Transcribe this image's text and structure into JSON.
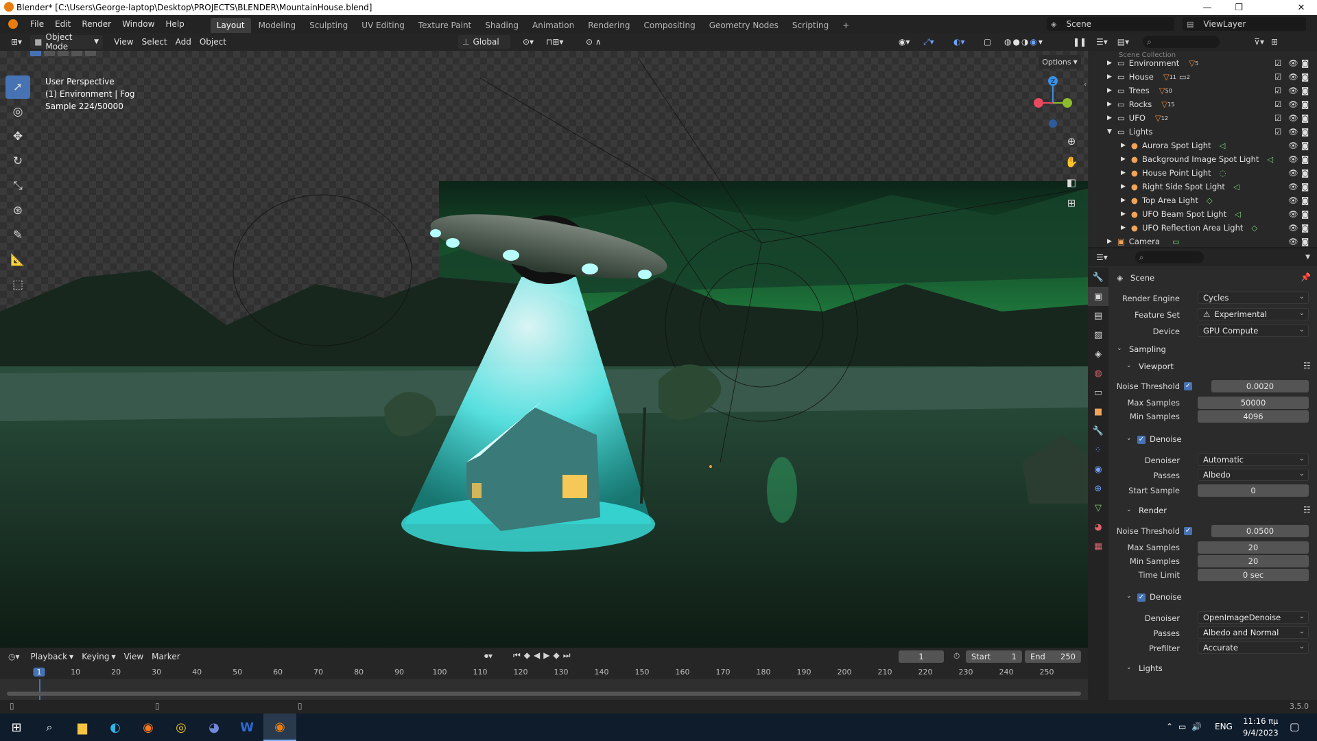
{
  "window": {
    "title": "Blender* [C:\\Users\\George-laptop\\Desktop\\PROJECTS\\BLENDER\\MountainHouse.blend]",
    "minimize": "—",
    "maximize": "❐",
    "close": "✕"
  },
  "menu": [
    "File",
    "Edit",
    "Render",
    "Window",
    "Help"
  ],
  "workspaces": [
    "Layout",
    "Modeling",
    "Sculpting",
    "UV Editing",
    "Texture Paint",
    "Shading",
    "Animation",
    "Rendering",
    "Compositing",
    "Geometry Nodes",
    "Scripting"
  ],
  "add_workspace": "+",
  "scene": {
    "name": "Scene",
    "view_layer": "ViewLayer"
  },
  "viewport_header": {
    "mode": "Object Mode",
    "menus": [
      "View",
      "Select",
      "Add",
      "Object"
    ],
    "orientation": "Global",
    "options": "Options"
  },
  "overlay_text": {
    "line1": "User Perspective",
    "line2": "(1) Environment | Fog",
    "line3": "Sample 224/50000"
  },
  "gizmo": {
    "z": "Z",
    "y": "Y",
    "x": "X"
  },
  "outliner": {
    "partial_top": "Scene Collection",
    "collections": [
      {
        "name": "Environment",
        "count": "5"
      },
      {
        "name": "House",
        "count": "11"
      },
      {
        "name": "Trees",
        "count": "50"
      },
      {
        "name": "Rocks",
        "count": "15"
      },
      {
        "name": "UFO",
        "count": "12"
      },
      {
        "name": "Lights",
        "count": ""
      }
    ],
    "lights": [
      "Aurora Spot Light",
      "Background Image Spot Light",
      "House Point Light",
      "Right Side Spot Light",
      "Top Area Light",
      "UFO Beam Spot Light",
      "UFO Reflection Area Light"
    ],
    "camera": "Camera",
    "house_sub": "2"
  },
  "properties": {
    "header": "Scene",
    "render_engine_label": "Render Engine",
    "render_engine": "Cycles",
    "feature_set_label": "Feature Set",
    "feature_set": "Experimental",
    "device_label": "Device",
    "device": "GPU Compute",
    "sampling": "Sampling",
    "viewport": "Viewport",
    "v_noise_label": "Noise Threshold",
    "v_noise": "0.0020",
    "v_max_label": "Max Samples",
    "v_max": "50000",
    "v_min_label": "Min Samples",
    "v_min": "4096",
    "v_denoise": "Denoise",
    "v_denoiser_label": "Denoiser",
    "v_denoiser": "Automatic",
    "v_passes_label": "Passes",
    "v_passes": "Albedo",
    "v_start_label": "Start Sample",
    "v_start": "0",
    "render": "Render",
    "r_noise_label": "Noise Threshold",
    "r_noise": "0.0500",
    "r_max_label": "Max Samples",
    "r_max": "20",
    "r_min_label": "Min Samples",
    "r_min": "20",
    "r_time_label": "Time Limit",
    "r_time": "0 sec",
    "r_denoise": "Denoise",
    "r_denoiser_label": "Denoiser",
    "r_denoiser": "OpenImageDenoise",
    "r_passes_label": "Passes",
    "r_passes": "Albedo and Normal",
    "r_prefilter_label": "Prefilter",
    "r_prefilter": "Accurate",
    "lights": "Lights"
  },
  "timeline": {
    "menus": [
      "Playback",
      "Keying",
      "View",
      "Marker"
    ],
    "current_frame": "1",
    "start_label": "Start",
    "start": "1",
    "end_label": "End",
    "end": "250",
    "ticks": [
      "1",
      "10",
      "20",
      "30",
      "40",
      "50",
      "60",
      "70",
      "80",
      "90",
      "100",
      "110",
      "120",
      "130",
      "140",
      "150",
      "160",
      "170",
      "180",
      "190",
      "200",
      "210",
      "220",
      "230",
      "240",
      "250"
    ]
  },
  "statusbar": {
    "version": "3.5.0"
  },
  "taskbar": {
    "lang": "ENG",
    "time": "11:16 πμ",
    "date": "9/4/2023"
  }
}
